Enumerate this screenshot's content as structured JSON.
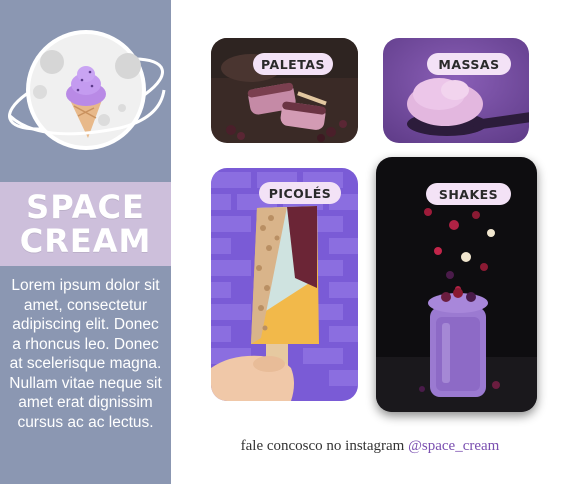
{
  "brand": {
    "line1": "SPACE",
    "line2": "CREAM"
  },
  "sidebar": {
    "description": "Lorem ipsum dolor sit amet, consectetur adipiscing elit. Donec a rhoncus leo. Donec at scelerisque magna. Nullam vitae neque sit amet erat dignissim cursus ac ac lectus."
  },
  "categories": [
    {
      "label": "PALETAS"
    },
    {
      "label": "MASSAS"
    },
    {
      "label": "PICOLÉS"
    },
    {
      "label": "SHAKES"
    }
  ],
  "footer": {
    "text": "fale concosco no instagram",
    "handle": "@space_cream"
  },
  "colors": {
    "sidebar": "#8b97b2",
    "band": "#cdbfdb",
    "pill": "#f3e2f6",
    "link": "#7a4fb0"
  }
}
